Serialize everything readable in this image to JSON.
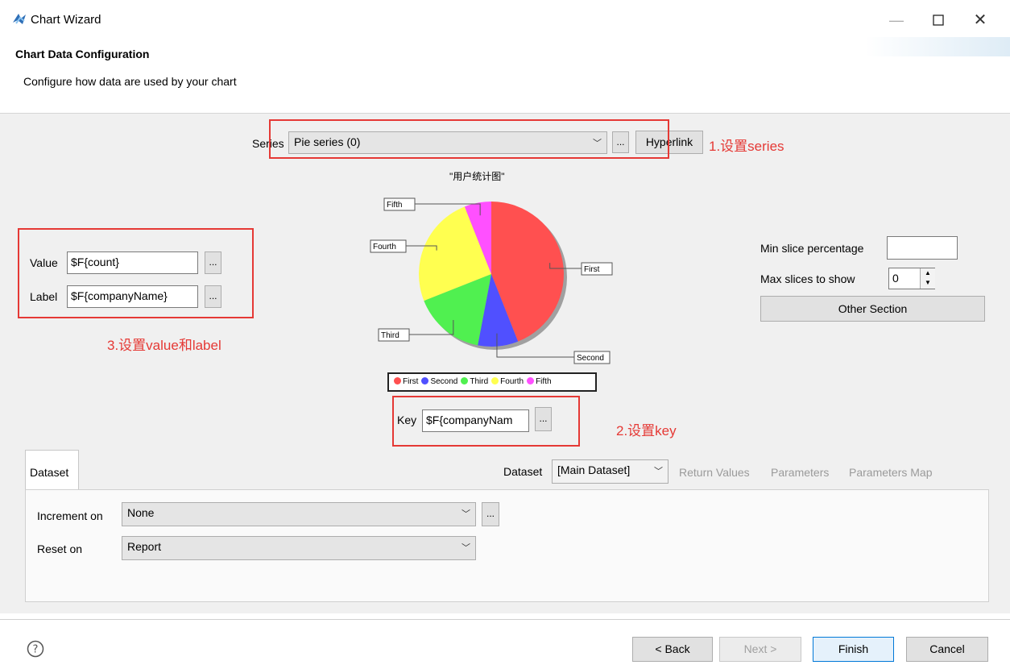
{
  "window": {
    "title": "Chart Wizard",
    "minimize_icon": "minimize-icon",
    "maximize_icon": "maximize-icon",
    "close_icon": "close-icon"
  },
  "header": {
    "title": "Chart Data Configuration",
    "subtitle": "Configure how data are used by your chart"
  },
  "series": {
    "label": "Series",
    "selected": "Pie series (0)",
    "more_label": "...",
    "hyperlink_label": "Hyperlink",
    "annotation": "1.设置series"
  },
  "value_label_group": {
    "value_label": "Value",
    "value": "$F{count}",
    "label_label": "Label",
    "label_value": "$F{companyName}",
    "more_label": "...",
    "annotation": "3.设置value和label"
  },
  "chart_data": {
    "type": "pie",
    "title": "\"用户统计图\"",
    "categories": [
      "First",
      "Second",
      "Third",
      "Fourth",
      "Fifth"
    ],
    "values": [
      44,
      9,
      16,
      25,
      6
    ],
    "colors": [
      "#ff5050",
      "#5050ff",
      "#50f050",
      "#ffff50",
      "#ff50ff"
    ]
  },
  "key": {
    "label": "Key",
    "value": "$F{companyNam",
    "more_label": "...",
    "annotation": "2.设置key"
  },
  "slice_options": {
    "min_slice_label": "Min slice percentage",
    "min_slice_value": "",
    "max_slices_label": "Max slices to show",
    "max_slices_value": "0",
    "other_section_label": "Other Section"
  },
  "dataset_section": {
    "tab_label": "Dataset",
    "dataset_label": "Dataset",
    "dataset_selected": "[Main Dataset]",
    "links": [
      "Return Values",
      "Parameters",
      "Parameters Map"
    ],
    "increment_on_label": "Increment on",
    "increment_on_value": "None",
    "reset_on_label": "Reset on",
    "reset_on_value": "Report",
    "more_label": "..."
  },
  "footer": {
    "help_icon": "help-icon",
    "back_label": "< Back",
    "next_label": "Next >",
    "finish_label": "Finish",
    "cancel_label": "Cancel"
  }
}
